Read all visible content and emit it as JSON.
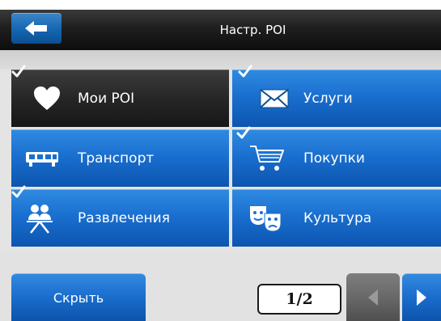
{
  "header": {
    "title": "Настр. POI",
    "back_icon": "arrow-left-icon"
  },
  "categories": [
    {
      "label": "Мои POI",
      "icon": "heart-icon",
      "checked": true,
      "selected": true
    },
    {
      "label": "Услуги",
      "icon": "envelope-icon",
      "checked": true,
      "selected": false
    },
    {
      "label": "Транспорт",
      "icon": "bus-icon",
      "checked": false,
      "selected": false
    },
    {
      "label": "Покупки",
      "icon": "shopping-cart-icon",
      "checked": true,
      "selected": false
    },
    {
      "label": "Развлечения",
      "icon": "people-icon",
      "checked": true,
      "selected": false
    },
    {
      "label": "Культура",
      "icon": "theater-masks-icon",
      "checked": false,
      "selected": false
    }
  ],
  "footer": {
    "hide_label": "Скрыть",
    "page_indicator": "1/2",
    "prev_icon": "triangle-left-icon",
    "next_icon": "triangle-right-icon"
  },
  "colors": {
    "accent_blue": "#1a6fcf",
    "header_dark": "#1f1f1f",
    "selected_tile": "#262626",
    "disabled_button": "#666666"
  }
}
